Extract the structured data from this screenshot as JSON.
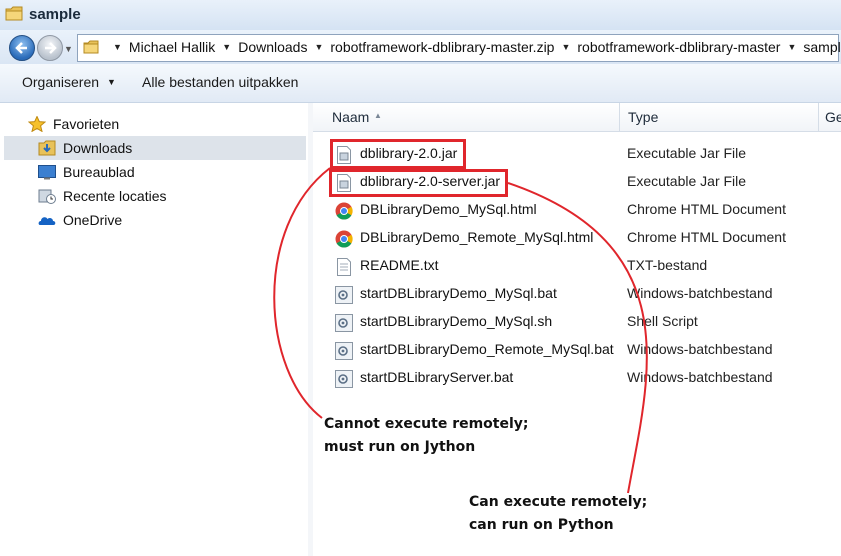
{
  "window": {
    "title": "sample"
  },
  "address_bar": {
    "crumbs": [
      "Michael Hallik",
      "Downloads",
      "robotframework-dblibrary-master.zip",
      "robotframework-dblibrary-master",
      "sample"
    ]
  },
  "toolbar": {
    "organize_label": "Organiseren",
    "extract_label": "Alle bestanden uitpakken"
  },
  "nav_pane": {
    "items": [
      {
        "label": "Favorieten",
        "icon": "star-icon",
        "selected": false
      },
      {
        "label": "Downloads",
        "icon": "downloads-folder-icon",
        "selected": true
      },
      {
        "label": "Bureaublad",
        "icon": "desktop-icon",
        "selected": false
      },
      {
        "label": "Recente locaties",
        "icon": "recent-places-icon",
        "selected": false
      },
      {
        "label": "OneDrive",
        "icon": "onedrive-icon",
        "selected": false
      }
    ]
  },
  "file_list": {
    "columns": {
      "name": "Naam",
      "type": "Type",
      "extra": "Ge"
    },
    "files": [
      {
        "name": "dblibrary-2.0.jar",
        "type": "Executable Jar File",
        "icon": "jar-file-icon"
      },
      {
        "name": "dblibrary-2.0-server.jar",
        "type": "Executable Jar File",
        "icon": "jar-file-icon"
      },
      {
        "name": "DBLibraryDemo_MySql.html",
        "type": "Chrome HTML Document",
        "icon": "chrome-icon"
      },
      {
        "name": "DBLibraryDemo_Remote_MySql.html",
        "type": "Chrome HTML Document",
        "icon": "chrome-icon"
      },
      {
        "name": "README.txt",
        "type": "TXT-bestand",
        "icon": "text-file-icon"
      },
      {
        "name": "startDBLibraryDemo_MySql.bat",
        "type": "Windows-batchbestand",
        "icon": "batch-file-icon"
      },
      {
        "name": "startDBLibraryDemo_MySql.sh",
        "type": "Shell Script",
        "icon": "batch-file-icon"
      },
      {
        "name": "startDBLibraryDemo_Remote_MySql.bat",
        "type": "Windows-batchbestand",
        "icon": "batch-file-icon"
      },
      {
        "name": "startDBLibraryServer.bat",
        "type": "Windows-batchbestand",
        "icon": "batch-file-icon"
      }
    ]
  },
  "annotations": {
    "note1": [
      "Cannot execute remotely;",
      "must run on Jython"
    ],
    "note2": [
      "Can execute remotely;",
      "can run on Python"
    ],
    "color": "#e0262c"
  }
}
